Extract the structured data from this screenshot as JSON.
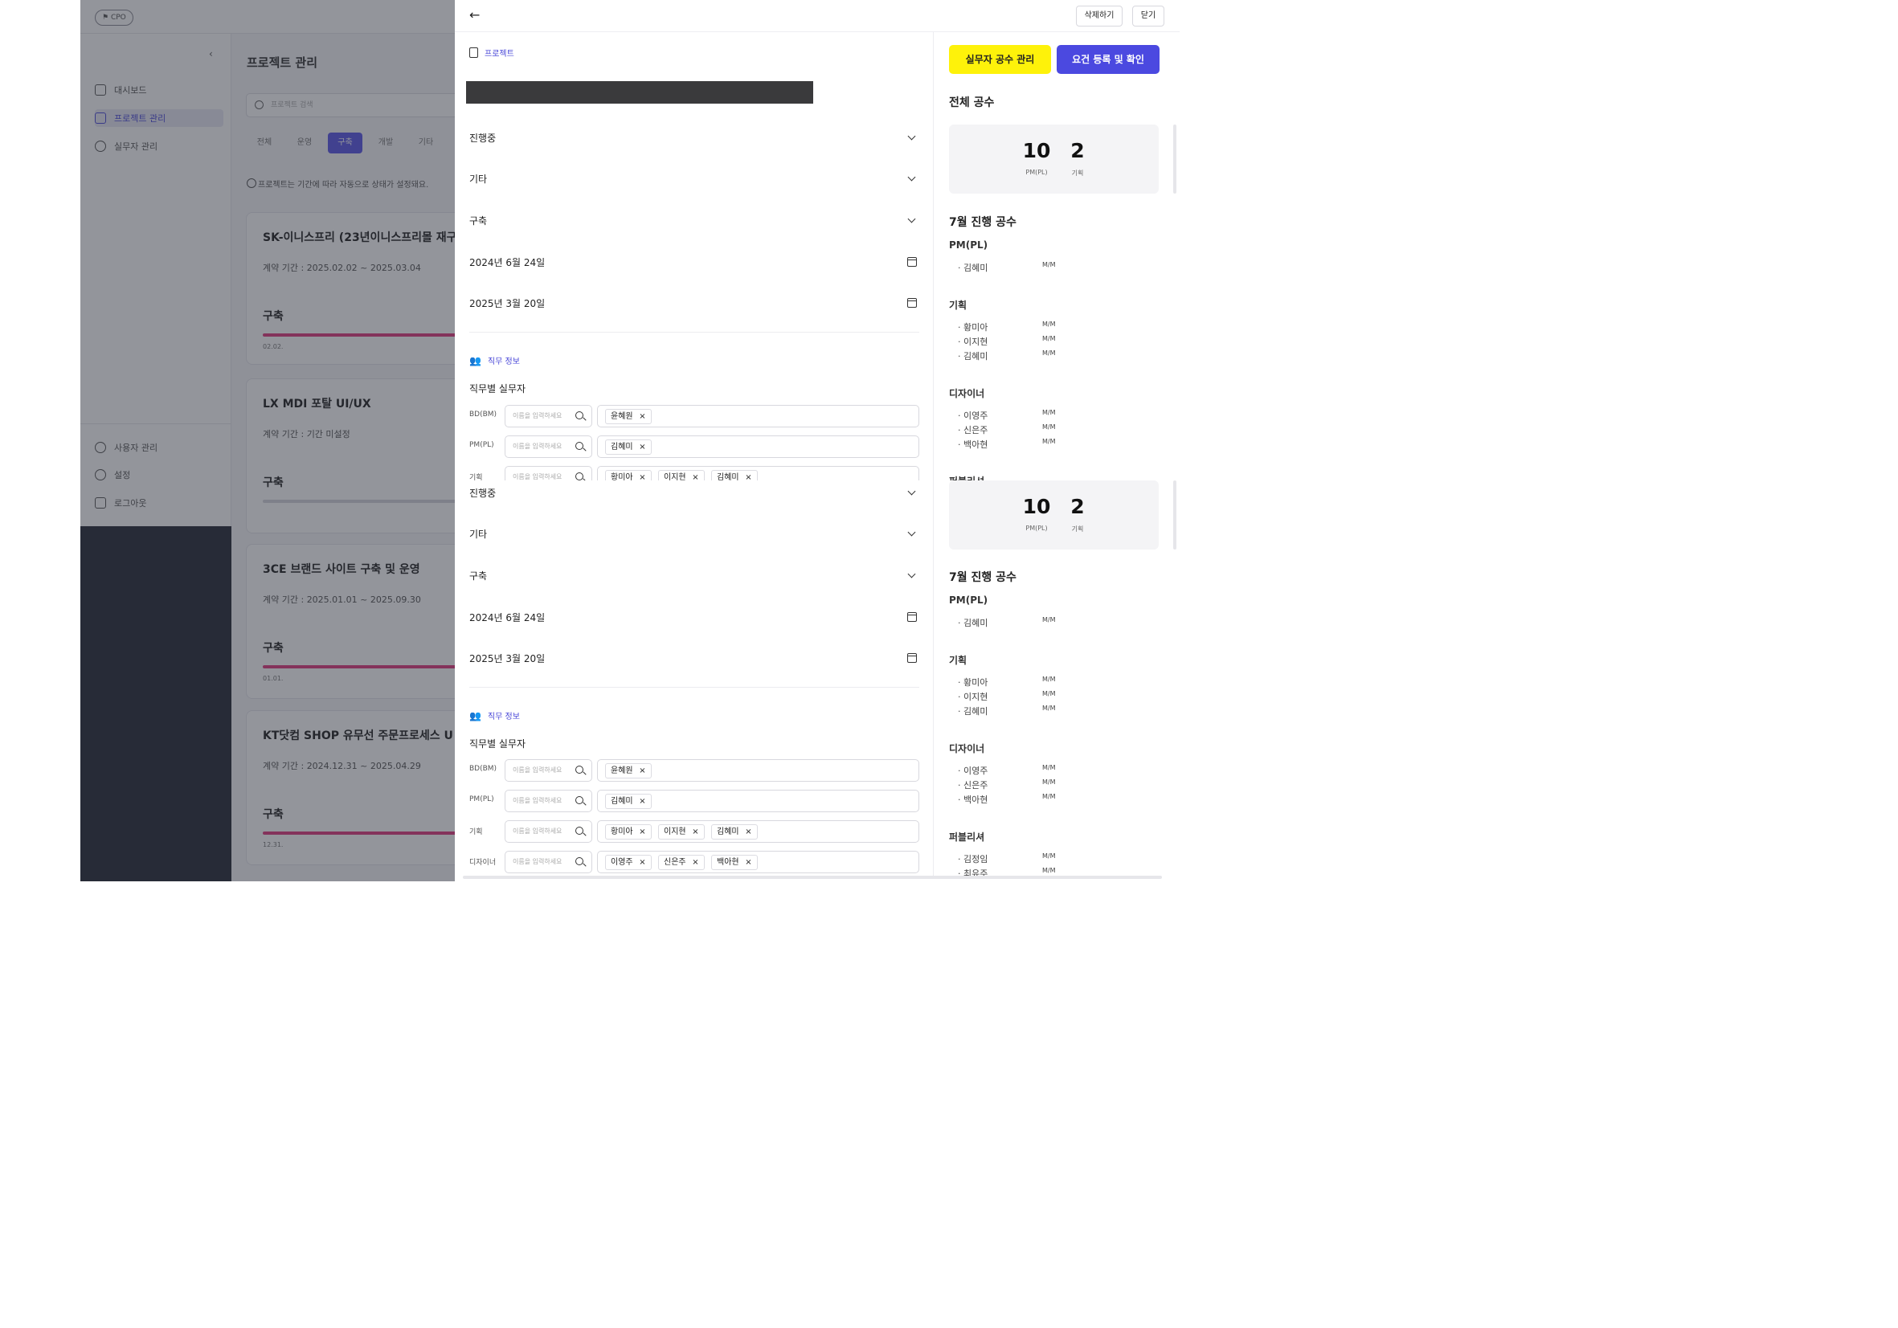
{
  "app": {
    "chip": "CPO",
    "nav": [
      "대시보드",
      "프로젝트 관리",
      "실무자 관리"
    ],
    "nav_bottom": [
      "사용자 관리",
      "설정",
      "로그아웃"
    ],
    "page_title": "프로젝트 관리",
    "search_placeholder": "프로젝트 검색",
    "filter_tabs": [
      "전체",
      "운영",
      "구축",
      "개발",
      "기타"
    ],
    "info": "프로젝트는 기간에 따라 자동으로 상태가 설정돼요.",
    "contract_prefix": "계약 기간 :",
    "cards": [
      {
        "title": "SK-이니스프리 (23년이니스프리몰 재구",
        "period": "2025.02.02 ~ 2025.03.04",
        "status": "구축",
        "date": "02.02.",
        "progress": 1.0
      },
      {
        "title": "LX MDI 포탈 UI/UX",
        "period": "기간 미설정",
        "status": "구축",
        "date": "",
        "progress": 0
      },
      {
        "title": "3CE 브랜드 사이트 구축 및 운영",
        "period": "2025.01.01 ~ 2025.09.30",
        "status": "구축",
        "date": "01.01.",
        "progress": 1.0
      },
      {
        "title": "KT닷컴 SHOP 유무선 주문프로세스 U",
        "period": "2024.12.31 ~ 2025.04.29",
        "status": "구축",
        "date": "12.31.",
        "progress": 1.0
      }
    ]
  },
  "modal": {
    "delete": "삭제하기",
    "close": "닫기",
    "section_project": "프로젝트",
    "status": "진행중",
    "type": "기타",
    "category": "구축",
    "start_date": "2024년 6월 24일",
    "end_date": "2025년 3월 20일",
    "section_job": "직무 정보",
    "job_title": "직무별 실무자",
    "input_placeholder": "이름을 입력하세요",
    "jobs": [
      {
        "label": "BD(BM)",
        "people": [
          "윤혜원"
        ]
      },
      {
        "label": "PM(PL)",
        "people": [
          "김혜미"
        ]
      },
      {
        "label": "기획",
        "people": [
          "황미아",
          "이지현",
          "김혜미"
        ]
      },
      {
        "label": "디자이너",
        "people": [
          "이영주",
          "신은주",
          "백아현"
        ]
      }
    ],
    "manage_btn": "실무자 공수 관리",
    "confirm_btn": "요건 등록 및 확인",
    "total_title": "전체 공수",
    "stats": [
      {
        "value": "10",
        "label": "PM(PL)"
      },
      {
        "value": "2",
        "label": "기획"
      }
    ],
    "month_title": "7월 진행 공수",
    "mm": "M/M",
    "groups": [
      {
        "name": "PM(PL)",
        "people": [
          "김혜미"
        ]
      },
      {
        "name": "기획",
        "people": [
          "황미아",
          "이지현",
          "김혜미"
        ]
      },
      {
        "name": "디자이너",
        "people": [
          "이영주",
          "신은주",
          "백아현"
        ]
      },
      {
        "name": "퍼블리셔",
        "people": [
          "김정임",
          "최유주"
        ]
      }
    ],
    "colors": {
      "yellow": "#fef20a",
      "primary": "#4b49e0",
      "pink": "#e03a7e"
    }
  }
}
